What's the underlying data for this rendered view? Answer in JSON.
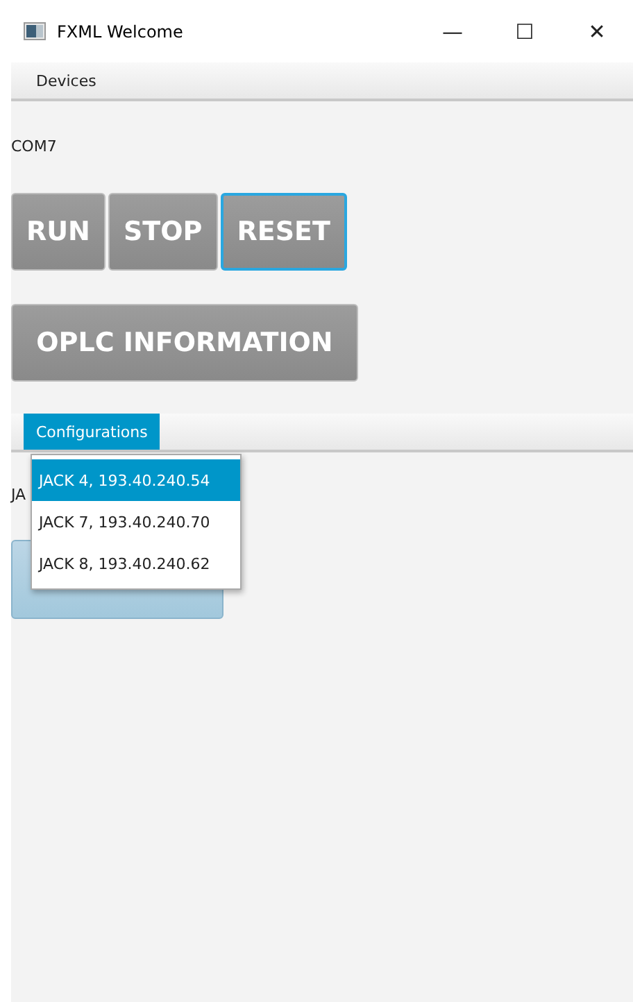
{
  "window": {
    "title": "FXML Welcome",
    "controls": [
      "—",
      "☐",
      "✕"
    ]
  },
  "menu_bar": [
    {
      "label": "Devices",
      "selected": false
    }
  ],
  "port_label": "COM7",
  "control_buttons": [
    {
      "label": "RUN",
      "focused": false
    },
    {
      "label": "STOP",
      "focused": false
    },
    {
      "label": "RESET",
      "focused": true
    }
  ],
  "info_button": {
    "label": "OPLC INFORMATION"
  },
  "config_menu_bar": [
    {
      "label": "Configurations",
      "selected": true
    }
  ],
  "config_menu_items": [
    {
      "label": "JACK 4, 193.40.240.54",
      "selected": true
    },
    {
      "label": "JACK 7, 193.40.240.70",
      "selected": false
    },
    {
      "label": "JACK 8, 193.40.240.62",
      "selected": false
    }
  ],
  "config_label": "JA",
  "set_config_button": {
    "disabled": true
  }
}
